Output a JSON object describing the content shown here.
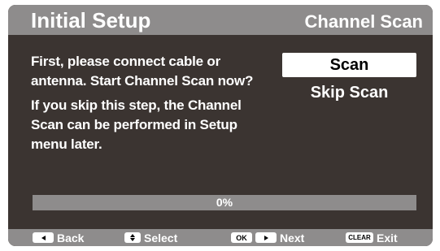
{
  "header": {
    "title": "Initial Setup",
    "section": "Channel Scan"
  },
  "message": {
    "line1": "First, please connect cable or antenna. Start Channel Scan now?",
    "line2": "If you skip this step, the Channel Scan can be performed in Setup menu later."
  },
  "options": {
    "scan_label": "Scan",
    "skip_label": "Skip Scan",
    "selected": "Scan"
  },
  "progress": {
    "label": "0%",
    "fraction": 0
  },
  "footer": {
    "back_label": "Back",
    "select_label": "Select",
    "ok_key": "OK",
    "next_label": "Next",
    "clear_key": "CLEAR",
    "exit_label": "Exit"
  },
  "colors": {
    "panel_bg": "#3b3431",
    "bar_gray": "#8e8c8c",
    "text": "#ffffff",
    "selected_bg": "#ffffff"
  },
  "icons": {
    "back": "left-arrow-icon",
    "select": "up-down-arrow-icon",
    "next": "right-arrow-icon"
  }
}
